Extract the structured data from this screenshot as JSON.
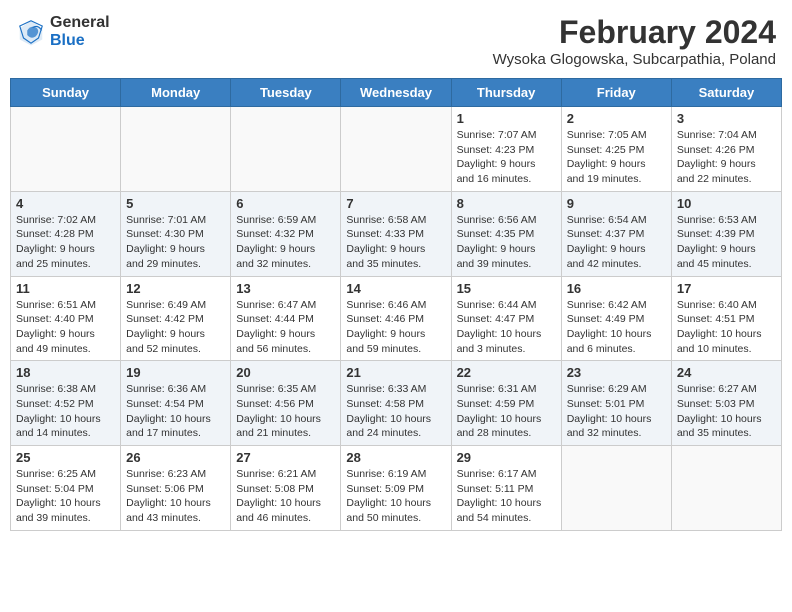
{
  "header": {
    "logo_general": "General",
    "logo_blue": "Blue",
    "main_title": "February 2024",
    "subtitle": "Wysoka Glogowska, Subcarpathia, Poland"
  },
  "columns": [
    "Sunday",
    "Monday",
    "Tuesday",
    "Wednesday",
    "Thursday",
    "Friday",
    "Saturday"
  ],
  "weeks": [
    {
      "stripe": false,
      "days": [
        {
          "num": "",
          "info": ""
        },
        {
          "num": "",
          "info": ""
        },
        {
          "num": "",
          "info": ""
        },
        {
          "num": "",
          "info": ""
        },
        {
          "num": "1",
          "info": "Sunrise: 7:07 AM\nSunset: 4:23 PM\nDaylight: 9 hours\nand 16 minutes."
        },
        {
          "num": "2",
          "info": "Sunrise: 7:05 AM\nSunset: 4:25 PM\nDaylight: 9 hours\nand 19 minutes."
        },
        {
          "num": "3",
          "info": "Sunrise: 7:04 AM\nSunset: 4:26 PM\nDaylight: 9 hours\nand 22 minutes."
        }
      ]
    },
    {
      "stripe": true,
      "days": [
        {
          "num": "4",
          "info": "Sunrise: 7:02 AM\nSunset: 4:28 PM\nDaylight: 9 hours\nand 25 minutes."
        },
        {
          "num": "5",
          "info": "Sunrise: 7:01 AM\nSunset: 4:30 PM\nDaylight: 9 hours\nand 29 minutes."
        },
        {
          "num": "6",
          "info": "Sunrise: 6:59 AM\nSunset: 4:32 PM\nDaylight: 9 hours\nand 32 minutes."
        },
        {
          "num": "7",
          "info": "Sunrise: 6:58 AM\nSunset: 4:33 PM\nDaylight: 9 hours\nand 35 minutes."
        },
        {
          "num": "8",
          "info": "Sunrise: 6:56 AM\nSunset: 4:35 PM\nDaylight: 9 hours\nand 39 minutes."
        },
        {
          "num": "9",
          "info": "Sunrise: 6:54 AM\nSunset: 4:37 PM\nDaylight: 9 hours\nand 42 minutes."
        },
        {
          "num": "10",
          "info": "Sunrise: 6:53 AM\nSunset: 4:39 PM\nDaylight: 9 hours\nand 45 minutes."
        }
      ]
    },
    {
      "stripe": false,
      "days": [
        {
          "num": "11",
          "info": "Sunrise: 6:51 AM\nSunset: 4:40 PM\nDaylight: 9 hours\nand 49 minutes."
        },
        {
          "num": "12",
          "info": "Sunrise: 6:49 AM\nSunset: 4:42 PM\nDaylight: 9 hours\nand 52 minutes."
        },
        {
          "num": "13",
          "info": "Sunrise: 6:47 AM\nSunset: 4:44 PM\nDaylight: 9 hours\nand 56 minutes."
        },
        {
          "num": "14",
          "info": "Sunrise: 6:46 AM\nSunset: 4:46 PM\nDaylight: 9 hours\nand 59 minutes."
        },
        {
          "num": "15",
          "info": "Sunrise: 6:44 AM\nSunset: 4:47 PM\nDaylight: 10 hours\nand 3 minutes."
        },
        {
          "num": "16",
          "info": "Sunrise: 6:42 AM\nSunset: 4:49 PM\nDaylight: 10 hours\nand 6 minutes."
        },
        {
          "num": "17",
          "info": "Sunrise: 6:40 AM\nSunset: 4:51 PM\nDaylight: 10 hours\nand 10 minutes."
        }
      ]
    },
    {
      "stripe": true,
      "days": [
        {
          "num": "18",
          "info": "Sunrise: 6:38 AM\nSunset: 4:52 PM\nDaylight: 10 hours\nand 14 minutes."
        },
        {
          "num": "19",
          "info": "Sunrise: 6:36 AM\nSunset: 4:54 PM\nDaylight: 10 hours\nand 17 minutes."
        },
        {
          "num": "20",
          "info": "Sunrise: 6:35 AM\nSunset: 4:56 PM\nDaylight: 10 hours\nand 21 minutes."
        },
        {
          "num": "21",
          "info": "Sunrise: 6:33 AM\nSunset: 4:58 PM\nDaylight: 10 hours\nand 24 minutes."
        },
        {
          "num": "22",
          "info": "Sunrise: 6:31 AM\nSunset: 4:59 PM\nDaylight: 10 hours\nand 28 minutes."
        },
        {
          "num": "23",
          "info": "Sunrise: 6:29 AM\nSunset: 5:01 PM\nDaylight: 10 hours\nand 32 minutes."
        },
        {
          "num": "24",
          "info": "Sunrise: 6:27 AM\nSunset: 5:03 PM\nDaylight: 10 hours\nand 35 minutes."
        }
      ]
    },
    {
      "stripe": false,
      "days": [
        {
          "num": "25",
          "info": "Sunrise: 6:25 AM\nSunset: 5:04 PM\nDaylight: 10 hours\nand 39 minutes."
        },
        {
          "num": "26",
          "info": "Sunrise: 6:23 AM\nSunset: 5:06 PM\nDaylight: 10 hours\nand 43 minutes."
        },
        {
          "num": "27",
          "info": "Sunrise: 6:21 AM\nSunset: 5:08 PM\nDaylight: 10 hours\nand 46 minutes."
        },
        {
          "num": "28",
          "info": "Sunrise: 6:19 AM\nSunset: 5:09 PM\nDaylight: 10 hours\nand 50 minutes."
        },
        {
          "num": "29",
          "info": "Sunrise: 6:17 AM\nSunset: 5:11 PM\nDaylight: 10 hours\nand 54 minutes."
        },
        {
          "num": "",
          "info": ""
        },
        {
          "num": "",
          "info": ""
        }
      ]
    }
  ]
}
